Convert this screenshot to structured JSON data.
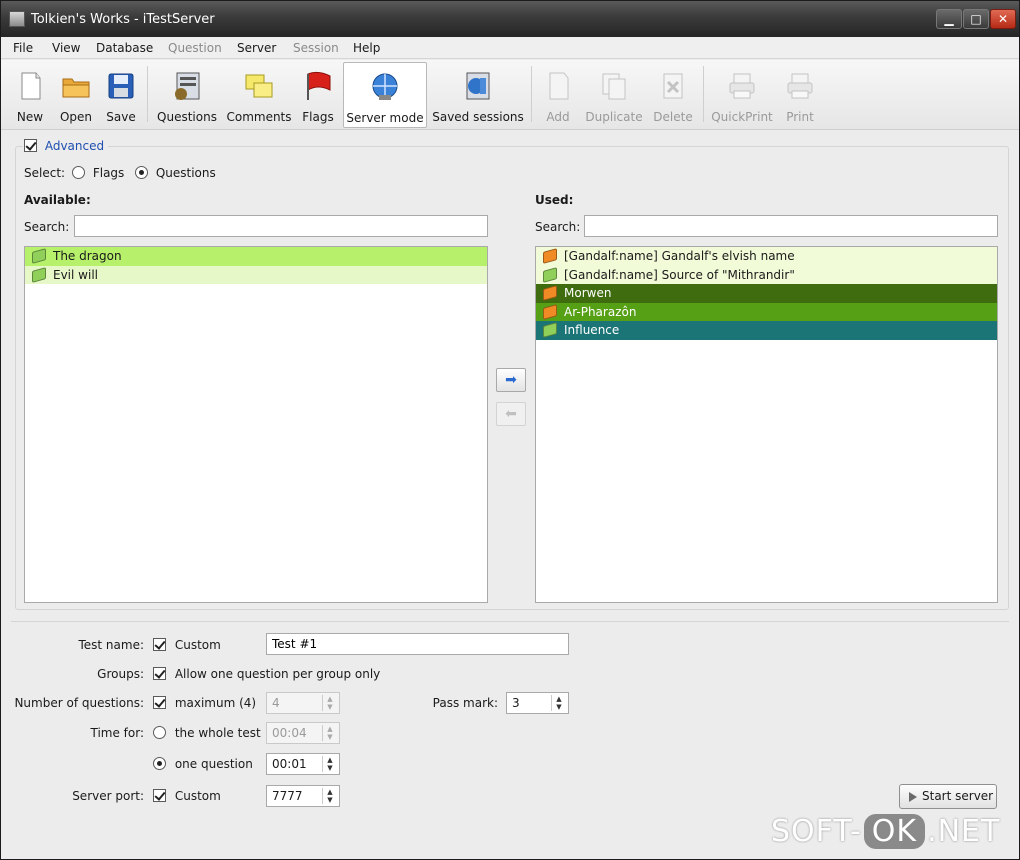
{
  "window": {
    "title": "Tolkien's Works - iTestServer"
  },
  "menu": [
    {
      "label": "File",
      "enabled": true
    },
    {
      "label": "View",
      "enabled": true
    },
    {
      "label": "Database",
      "enabled": true
    },
    {
      "label": "Question",
      "enabled": false
    },
    {
      "label": "Server",
      "enabled": true
    },
    {
      "label": "Session",
      "enabled": false
    },
    {
      "label": "Help",
      "enabled": true
    }
  ],
  "toolbar": {
    "new": "New",
    "open": "Open",
    "save": "Save",
    "questions": "Questions",
    "comments": "Comments",
    "flags": "Flags",
    "server_mode": "Server mode",
    "saved_sessions": "Saved sessions",
    "add": "Add",
    "duplicate": "Duplicate",
    "delete": "Delete",
    "quickprint": "QuickPrint",
    "print": "Print"
  },
  "advanced": {
    "label": "Advanced",
    "checked": true
  },
  "select": {
    "label": "Select:",
    "options": [
      "Flags",
      "Questions"
    ],
    "selected": "Questions"
  },
  "available": {
    "title": "Available:",
    "search_label": "Search:",
    "search_value": "",
    "items": [
      {
        "text": "The dragon",
        "bg": "#b7f06a",
        "icon": "#8fcf5a"
      },
      {
        "text": "Evil will",
        "bg": "#e6f8c8",
        "icon": "#8fcf5a"
      }
    ]
  },
  "used": {
    "title": "Used:",
    "search_label": "Search:",
    "search_value": "",
    "items": [
      {
        "text": "[Gandalf:name] Gandalf's elvish name",
        "bg": "#f2fbd8",
        "fg": "#1a1a1a",
        "icon": "#f08a24"
      },
      {
        "text": "[Gandalf:name] Source of \"Mithrandir\"",
        "bg": "#f2fbd8",
        "fg": "#1a1a1a",
        "icon": "#8fcf5a"
      },
      {
        "text": "Morwen",
        "bg": "#3f6c0f",
        "fg": "#ffffff",
        "icon": "#f08a24"
      },
      {
        "text": "Ar-Pharazôn",
        "bg": "#56a016",
        "fg": "#ffffff",
        "icon": "#f08a24"
      },
      {
        "text": "Influence",
        "bg": "#1b7476",
        "fg": "#ffffff",
        "icon": "#8fcf5a"
      }
    ]
  },
  "settings": {
    "test_name": {
      "label": "Test name:",
      "option": "Custom",
      "checked": true,
      "value": "Test #1"
    },
    "groups": {
      "label": "Groups:",
      "option": "Allow one question per group only",
      "checked": true
    },
    "num_questions": {
      "label": "Number of questions:",
      "option": "maximum (4)",
      "checked": true,
      "value": "4"
    },
    "pass_mark": {
      "label": "Pass mark:",
      "value": "3"
    },
    "time_for": {
      "label": "Time for:",
      "whole_test": "the whole test",
      "whole_value": "00:04",
      "one_question": "one question",
      "one_value": "00:01",
      "selected": "one question"
    },
    "server_port": {
      "label": "Server port:",
      "option": "Custom",
      "checked": true,
      "value": "7777"
    },
    "start_button": "Start server"
  },
  "watermark": {
    "left": "SOFT-",
    "mid": "OK",
    "right": ".NET"
  }
}
